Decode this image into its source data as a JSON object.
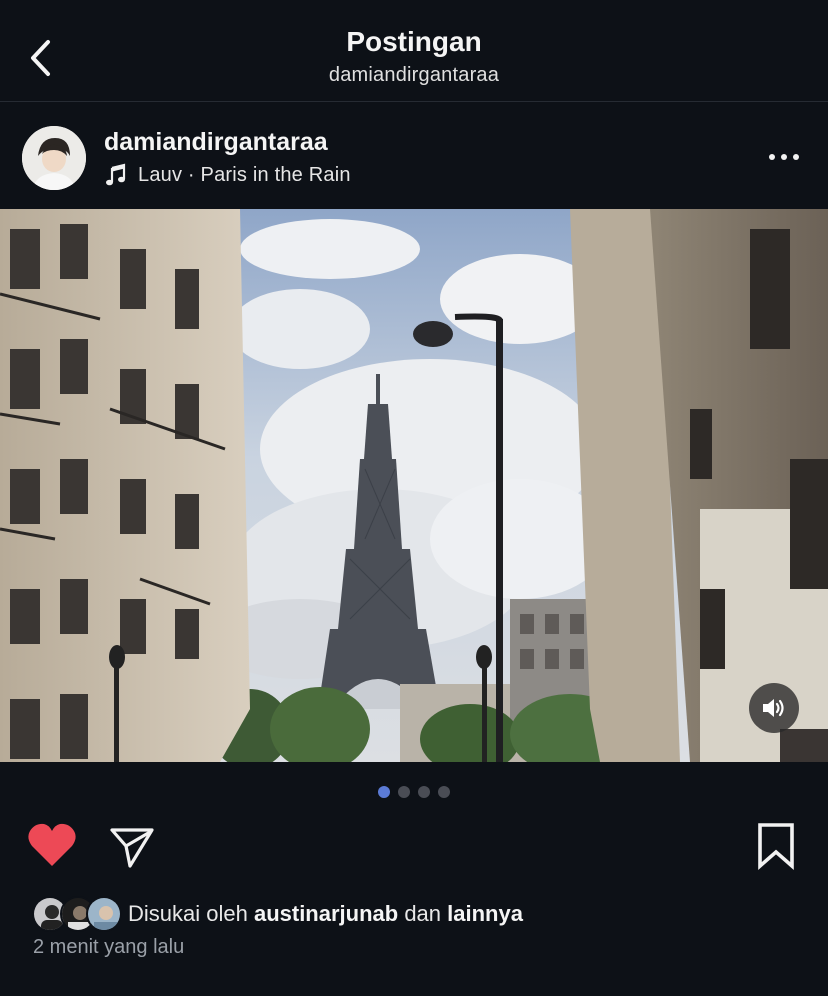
{
  "header": {
    "title": "Postingan",
    "subtitle": "damiandirgantaraa"
  },
  "post": {
    "username": "damiandirgantaraa",
    "music": "Lauv · Paris in the Rain",
    "carousel": {
      "count": 4,
      "active_index": 0
    },
    "liked": true,
    "likes": {
      "prefix": "Disukai oleh ",
      "first_user": "austinarjunab",
      "connector": " dan ",
      "others": "lainnya"
    },
    "timestamp": "2 menit yang lalu"
  },
  "colors": {
    "background": "#0d1117",
    "like_red": "#ed4956",
    "dot_active": "#5b7bd6",
    "dot_inactive": "#4a4d55"
  },
  "icons": {
    "back": "chevron-left-icon",
    "music": "music-note-icon",
    "more": "more-horizontal-icon",
    "sound": "speaker-icon",
    "like": "heart-icon",
    "share": "paper-plane-icon",
    "save": "bookmark-icon"
  }
}
